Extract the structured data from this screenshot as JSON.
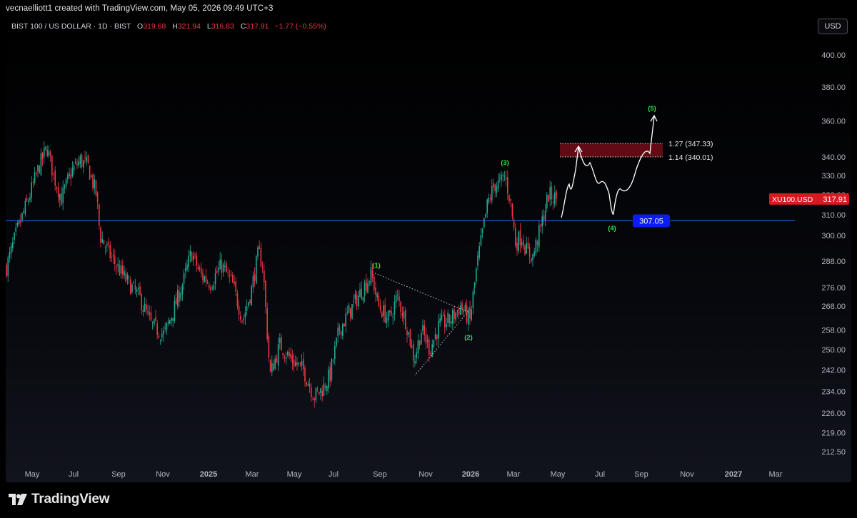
{
  "header": {
    "credit": "vecnaelliott1 created with TradingView.com, May 05, 2026 09:49 UTC+3"
  },
  "legend": {
    "symbol": "BIST 100 / US DOLLAR · 1D · BIST",
    "o_label": "O",
    "o_value": "319.68",
    "h_label": "H",
    "h_value": "321.94",
    "l_label": "L",
    "l_value": "316.83",
    "c_label": "C",
    "c_value": "317.91",
    "change": "−1.77 (−0.55%)"
  },
  "currency_button": "USD",
  "price_axis": {
    "ticks": [
      "400.00",
      "380.00",
      "360.00",
      "340.00",
      "330.00",
      "320.00",
      "310.00",
      "300.00",
      "288.00",
      "276.00",
      "268.00",
      "258.00",
      "250.00",
      "242.00",
      "234.00",
      "226.00",
      "219.00",
      "212.50"
    ],
    "last_price_symbol": "XU100.USD",
    "last_price_value": "317.91",
    "horizontal_level_label": "307.05"
  },
  "time_axis": {
    "labels": [
      "May",
      "Jul",
      "Sep",
      "Nov",
      "2025",
      "Mar",
      "May",
      "Jul",
      "Sep",
      "Nov",
      "2026",
      "Mar",
      "May",
      "Jul",
      "Sep",
      "Nov",
      "2027",
      "Mar"
    ],
    "bold_labels": [
      "2025",
      "2026",
      "2027"
    ]
  },
  "annotations": {
    "wave1": "(1)",
    "wave2": "(2)",
    "wave3": "(3)",
    "wave4": "(4)",
    "wave5": "(5)",
    "fib_127": "1.27 (347.33)",
    "fib_114": "1.14 (340.01)"
  },
  "chart_data": {
    "type": "candlestick",
    "symbol": "XU100.USD",
    "x": [
      "2024-04",
      "2024-05",
      "2024-06",
      "2024-07",
      "2024-08",
      "2024-09",
      "2024-10",
      "2024-11",
      "2024-12",
      "2025-01",
      "2025-02",
      "2025-03",
      "2025-04",
      "2025-05",
      "2025-06",
      "2025-07",
      "2025-08",
      "2025-09",
      "2025-10",
      "2025-11",
      "2025-12",
      "2026-01",
      "2026-02",
      "2026-03",
      "2026-04",
      "2026-05"
    ],
    "close": [
      290,
      325,
      332,
      336,
      305,
      280,
      265,
      255,
      285,
      278,
      270,
      290,
      245,
      240,
      236,
      250,
      268,
      285,
      252,
      258,
      262,
      285,
      325,
      300,
      300,
      317.91
    ],
    "last_open": 319.68,
    "last_high": 321.94,
    "last_low": 316.83,
    "last_close": 317.91,
    "last_change": -1.77,
    "last_change_pct": -0.55,
    "horizontal_level": 307.05,
    "fib_levels": [
      {
        "ratio": 1.27,
        "price": 347.33
      },
      {
        "ratio": 1.14,
        "price": 340.01
      }
    ],
    "ylim": [
      208,
      410
    ],
    "colors": {
      "up": "#22ab94",
      "down": "#f23645",
      "level": "#2962ff",
      "fib_zone": "#6b0d16",
      "wave_label": "#2ee54a"
    }
  },
  "brand": {
    "logo_text": "TradingView"
  }
}
